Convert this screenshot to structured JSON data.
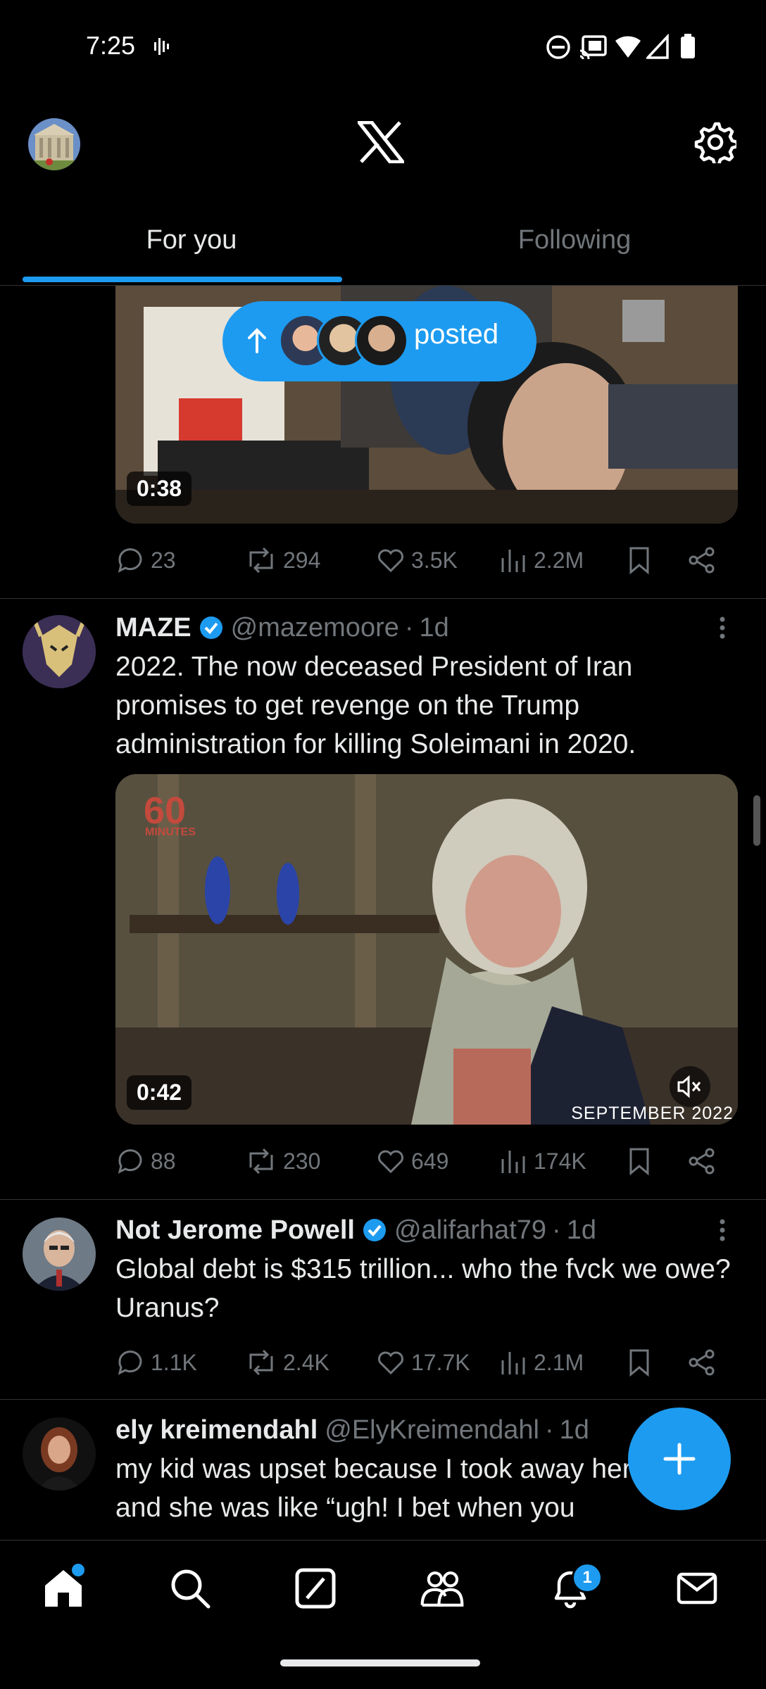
{
  "status_bar": {
    "time": "7:25"
  },
  "header": {
    "logo": "X"
  },
  "tabs": [
    {
      "label": "For you",
      "active": true
    },
    {
      "label": "Following",
      "active": false
    }
  ],
  "posted_pill": {
    "label": "posted"
  },
  "tweets": [
    {
      "media_duration": "0:38",
      "actions": {
        "replies": "23",
        "reposts": "294",
        "likes": "3.5K",
        "views": "2.2M"
      }
    },
    {
      "name": "MAZE",
      "handle": "@mazemoore",
      "time": "1d",
      "verified": true,
      "text": "2022. The now deceased President of Iran promises to get revenge on the Trump administration for killing Soleimani in 2020.",
      "media_duration": "0:42",
      "media_overlay": "SEPTEMBER 2022",
      "media_logo": "60",
      "media_logo_sub": "MINUTES",
      "actions": {
        "replies": "88",
        "reposts": "230",
        "likes": "649",
        "views": "174K"
      }
    },
    {
      "name": "Not Jerome Powell",
      "handle": "@alifarhat79",
      "time": "1d",
      "verified": true,
      "text": "Global debt is $315 trillion... who the fvck we owe? Uranus?",
      "actions": {
        "replies": "1.1K",
        "reposts": "2.4K",
        "likes": "17.7K",
        "views": "2.1M"
      }
    },
    {
      "name": "ely kreimendahl",
      "handle": "@ElyKreimendahl",
      "time": "1d",
      "verified": false,
      "text": "my kid was upset because I took away her iPad and she was like “ugh! I bet when you"
    }
  ],
  "bottom_nav": {
    "items": [
      "home-icon",
      "search-icon",
      "grok-icon",
      "communities-icon",
      "notifications-icon",
      "messages-icon"
    ],
    "notification_count": "1"
  },
  "colors": {
    "accent": "#1d9bf0",
    "background": "#000000",
    "muted": "#71767b"
  }
}
